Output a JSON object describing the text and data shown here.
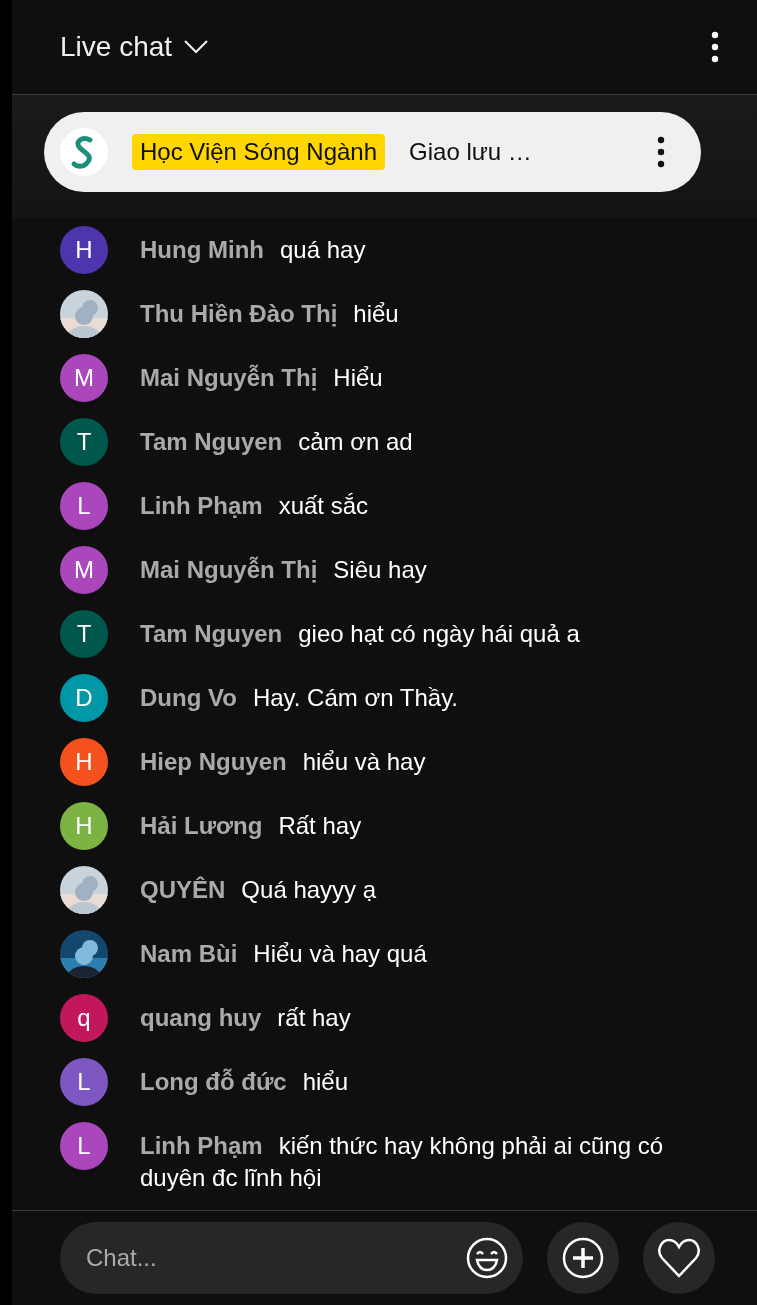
{
  "header": {
    "title": "Live chat"
  },
  "pinned": {
    "badge": "Học Viện Sóng Ngành",
    "message": "Giao lưu …"
  },
  "messages": [
    {
      "author": "Hung Minh",
      "message": "quá hay",
      "avatar": {
        "kind": "letter",
        "letter": "H",
        "color": "#4e34ad"
      }
    },
    {
      "author": "Thu Hiền Đào Thị",
      "message": "hiểu"
    },
    {
      "author": "Mai Nguyễn Thị",
      "message": "Hiểu",
      "avatar": {
        "kind": "letter",
        "letter": "M",
        "color": "#ab47bc"
      }
    },
    {
      "author": "Tam Nguyen",
      "message": "cảm ơn ad",
      "avatar": {
        "kind": "letter",
        "letter": "T",
        "color": "#00574b"
      }
    },
    {
      "author": "Linh Phạm",
      "message": "xuất sắc",
      "avatar": {
        "kind": "letter",
        "letter": "L",
        "color": "#ab47bc"
      }
    },
    {
      "author": "Mai Nguyễn Thị",
      "message": "Siêu hay",
      "avatar": {
        "kind": "letter",
        "letter": "M",
        "color": "#ab47bc"
      }
    },
    {
      "author": "Tam Nguyen",
      "message": "gieo hạt có ngày hái quả a",
      "avatar": {
        "kind": "letter",
        "letter": "T",
        "color": "#00574b"
      }
    },
    {
      "author": "Dung Vo",
      "message": "Hay. Cám ơn Thầy.",
      "avatar": {
        "kind": "letter",
        "letter": "D",
        "color": "#0097a7"
      }
    },
    {
      "author": "Hiep Nguyen",
      "message": "hiểu và hay",
      "avatar": {
        "kind": "letter",
        "letter": "H",
        "color": "#f4511e"
      }
    },
    {
      "author": "Hải Lương",
      "message": "Rất hay",
      "avatar": {
        "kind": "letter",
        "letter": "H",
        "color": "#7cb342"
      }
    },
    {
      "author": "QUYÊN",
      "message": "Quá hayyy ạ"
    },
    {
      "author": "Nam Bùi",
      "message": "Hiểu và hay quá"
    },
    {
      "author": "quang huy",
      "message": "rất hay",
      "avatar": {
        "kind": "letter",
        "letter": "q",
        "color": "#c2185b"
      }
    },
    {
      "author": "Long đỗ đức",
      "message": "hiểu",
      "avatar": {
        "kind": "letter",
        "letter": "L",
        "color": "#7e57c2"
      }
    },
    {
      "author": "Linh Phạm",
      "message": "kiến thức hay không phải ai cũng có duyên đc lĩnh hội",
      "avatar": {
        "kind": "letter",
        "letter": "L",
        "color": "#ab47bc"
      }
    }
  ],
  "input": {
    "placeholder": "Chat..."
  }
}
